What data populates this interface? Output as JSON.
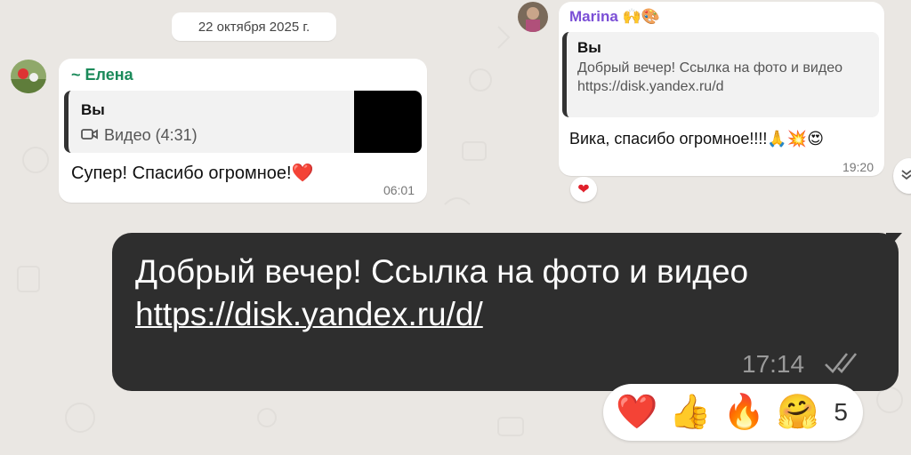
{
  "date_chip": "22 октября 2025 г.",
  "messages": {
    "elena": {
      "sender": "~ Елена",
      "quote_author": "Вы",
      "quote_media": "Видео (4:31)",
      "text": "Супер! Спасибо огромное!❤️",
      "time": "06:01"
    },
    "marina": {
      "sender": "Marina 🙌🎨",
      "quote_author": "Вы",
      "quote_text": "Добрый вечер! Ссылка на фото и видео https://disk.yandex.ru/d",
      "text": "Вика, спасибо огромное!!!!🙏💥😍",
      "time": "19:20",
      "reaction": "❤"
    },
    "outgoing": {
      "text": "Добрый вечер! Ссылка на фото и видео",
      "link": "https://disk.yandex.ru/d/",
      "time": "17:14",
      "status": "read"
    }
  },
  "reactions_bar": {
    "items": [
      "❤️",
      "👍",
      "🔥",
      "🤗"
    ],
    "count": "5"
  },
  "icons": [
    "video-icon",
    "double-check-icon",
    "scroll-down-icon"
  ],
  "colors": {
    "outgoing_bubble": "#2e2e2e",
    "elena_name": "#1b8a5a",
    "marina_name": "#7b4fd6",
    "background": "#eae7e3"
  }
}
